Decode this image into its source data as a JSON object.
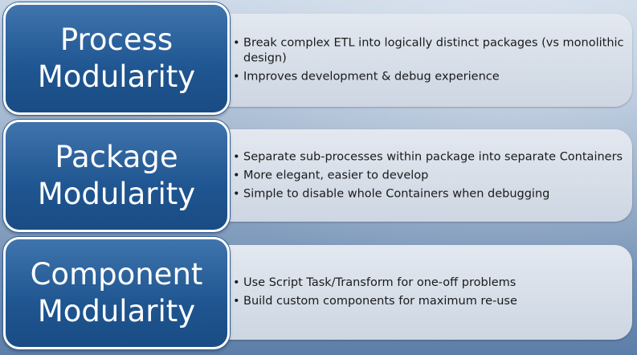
{
  "rows": [
    {
      "title_line1": "Process",
      "title_line2": "Modularity",
      "bullets": [
        "Break complex ETL into logically distinct packages (vs monolithic design)",
        "Improves development & debug experience"
      ]
    },
    {
      "title_line1": "Package",
      "title_line2": "Modularity",
      "bullets": [
        "Separate sub-processes within package into separate Containers",
        "More elegant, easier to develop",
        "Simple to disable whole Containers when debugging"
      ]
    },
    {
      "title_line1": "Component",
      "title_line2": "Modularity",
      "bullets": [
        "Use Script Task/Transform for one-off problems",
        "Build custom components for maximum re-use"
      ]
    }
  ],
  "colors": {
    "box_fill": "#1f5590",
    "box_border": "#ffffff",
    "panel_fill": "#d6dde8",
    "background": "#8aa6c8"
  }
}
